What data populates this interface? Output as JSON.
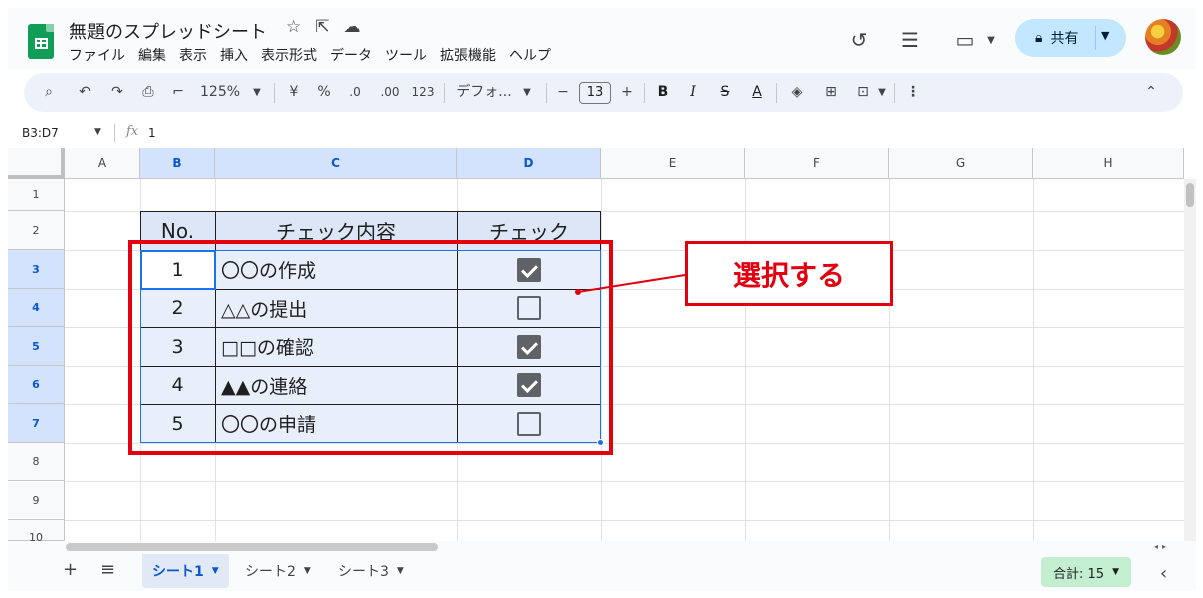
{
  "doc": {
    "title": "無題のスプレッドシート",
    "title_icons": [
      "star-icon",
      "move-to-folder-icon",
      "cloud-status-icon"
    ]
  },
  "menu": [
    "ファイル",
    "編集",
    "表示",
    "挿入",
    "表示形式",
    "データ",
    "ツール",
    "拡張機能",
    "ヘルプ"
  ],
  "header_actions": {
    "history_icon": "↺",
    "comment_icon": "☰",
    "meet_icon": "▭",
    "share_label": "共有"
  },
  "toolbar": {
    "zoom": "125%",
    "currency": "¥",
    "percent": "%",
    "decrease_decimal": ".0",
    "increase_decimal": ".00",
    "number_format": "123",
    "font": "デフォ...",
    "font_size": "13",
    "bold": "B",
    "italic": "I"
  },
  "formula_bar": {
    "range": "B3:D7",
    "fx": "fx",
    "value": "1"
  },
  "columns": [
    "A",
    "B",
    "C",
    "D",
    "E",
    "F",
    "G",
    "H"
  ],
  "selected_columns": [
    "B",
    "C",
    "D"
  ],
  "rows": [
    "1",
    "2",
    "3",
    "4",
    "5",
    "6",
    "7",
    "8",
    "9",
    "10"
  ],
  "selected_rows": [
    "3",
    "4",
    "5",
    "6",
    "7"
  ],
  "table": {
    "headers": [
      "No.",
      "チェック内容",
      "チェック"
    ],
    "rows": [
      {
        "no": "1",
        "content": "〇〇の作成",
        "checked": true
      },
      {
        "no": "2",
        "content": "△△の提出",
        "checked": false
      },
      {
        "no": "3",
        "content": "□□の確認",
        "checked": true
      },
      {
        "no": "4",
        "content": "▲▲の連絡",
        "checked": true
      },
      {
        "no": "5",
        "content": "〇〇の申請",
        "checked": false
      }
    ]
  },
  "annotation": {
    "label": "選択する",
    "color": "#e3000f"
  },
  "sheets": [
    {
      "name": "シート1",
      "active": true
    },
    {
      "name": "シート2",
      "active": false
    },
    {
      "name": "シート3",
      "active": false
    }
  ],
  "status": {
    "sum": "合計: 15"
  },
  "colors": {
    "accent": "#1a73e8",
    "share_bg": "#c2e7ff",
    "sum_bg": "#c4eed0",
    "selection_header": "#d3e3fd"
  }
}
